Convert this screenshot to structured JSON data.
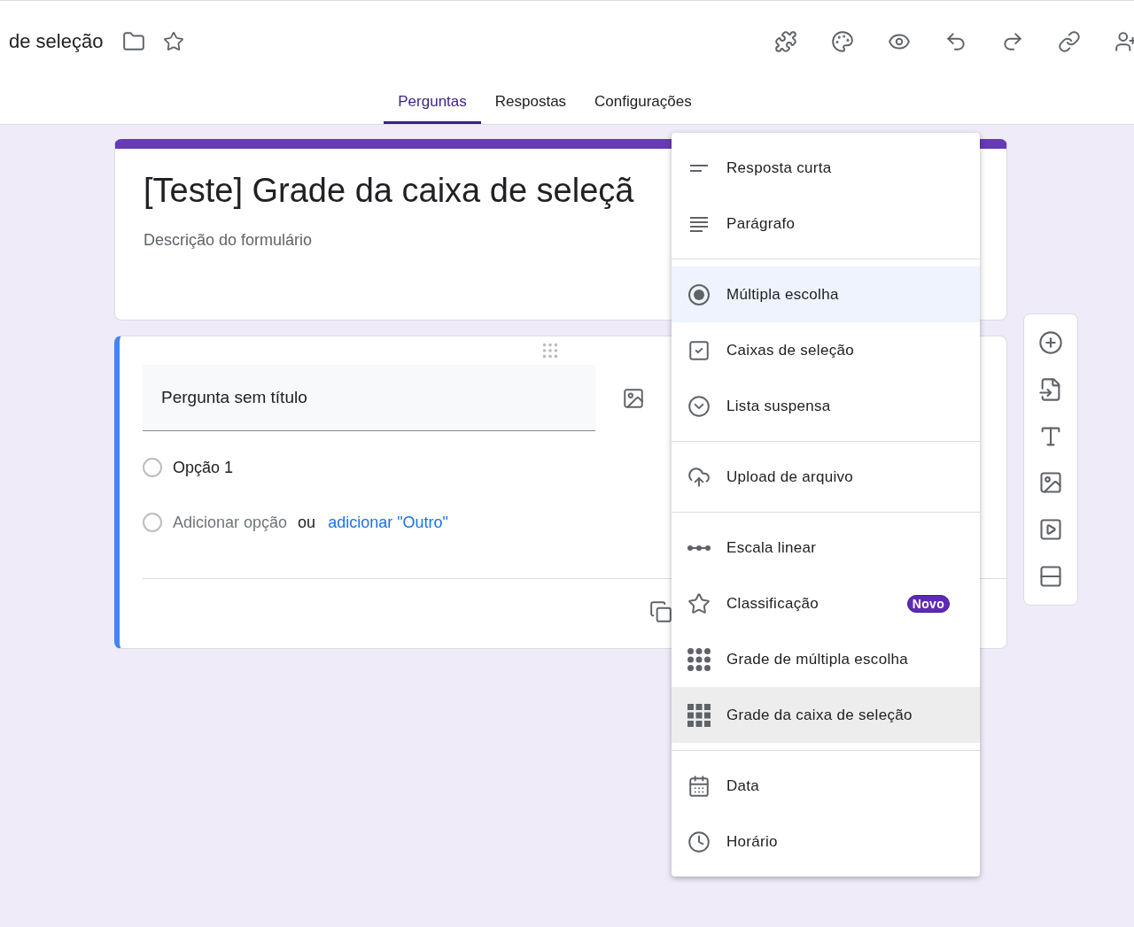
{
  "header": {
    "doc_title": "de seleção",
    "tabs": [
      {
        "label": "Perguntas",
        "selected": true
      },
      {
        "label": "Respostas",
        "selected": false
      },
      {
        "label": "Configurações",
        "selected": false
      }
    ]
  },
  "form_header": {
    "title": "[Teste] Grade da caixa de seleçã",
    "description": "Descrição do formulário"
  },
  "question": {
    "title": "Pergunta sem título",
    "options": [
      "Opção 1"
    ],
    "add_option": "Adicionar opção",
    "or": "ou",
    "add_other": "adicionar \"Outro\""
  },
  "type_menu": {
    "groups": [
      [
        {
          "kind": "short",
          "label": "Resposta curta",
          "selected": false,
          "hovered": false
        },
        {
          "kind": "paragraph",
          "label": "Parágrafo",
          "selected": false,
          "hovered": false
        }
      ],
      [
        {
          "kind": "radio",
          "label": "Múltipla escolha",
          "selected": true,
          "hovered": false
        },
        {
          "kind": "checkbox",
          "label": "Caixas de seleção",
          "selected": false,
          "hovered": false
        },
        {
          "kind": "dropdown",
          "label": "Lista suspensa",
          "selected": false,
          "hovered": false
        }
      ],
      [
        {
          "kind": "upload",
          "label": "Upload de arquivo",
          "selected": false,
          "hovered": false
        }
      ],
      [
        {
          "kind": "scale",
          "label": "Escala linear",
          "selected": false,
          "hovered": false
        },
        {
          "kind": "rating",
          "label": "Classificação",
          "badge": "Novo",
          "selected": false,
          "hovered": false
        },
        {
          "kind": "dotgrid",
          "label": "Grade de múltipla escolha",
          "selected": false,
          "hovered": false
        },
        {
          "kind": "squaregrid",
          "label": "Grade da caixa de seleção",
          "selected": false,
          "hovered": true
        }
      ],
      [
        {
          "kind": "date",
          "label": "Data",
          "selected": false,
          "hovered": false
        },
        {
          "kind": "time",
          "label": "Horário",
          "selected": false,
          "hovered": false
        }
      ]
    ]
  }
}
